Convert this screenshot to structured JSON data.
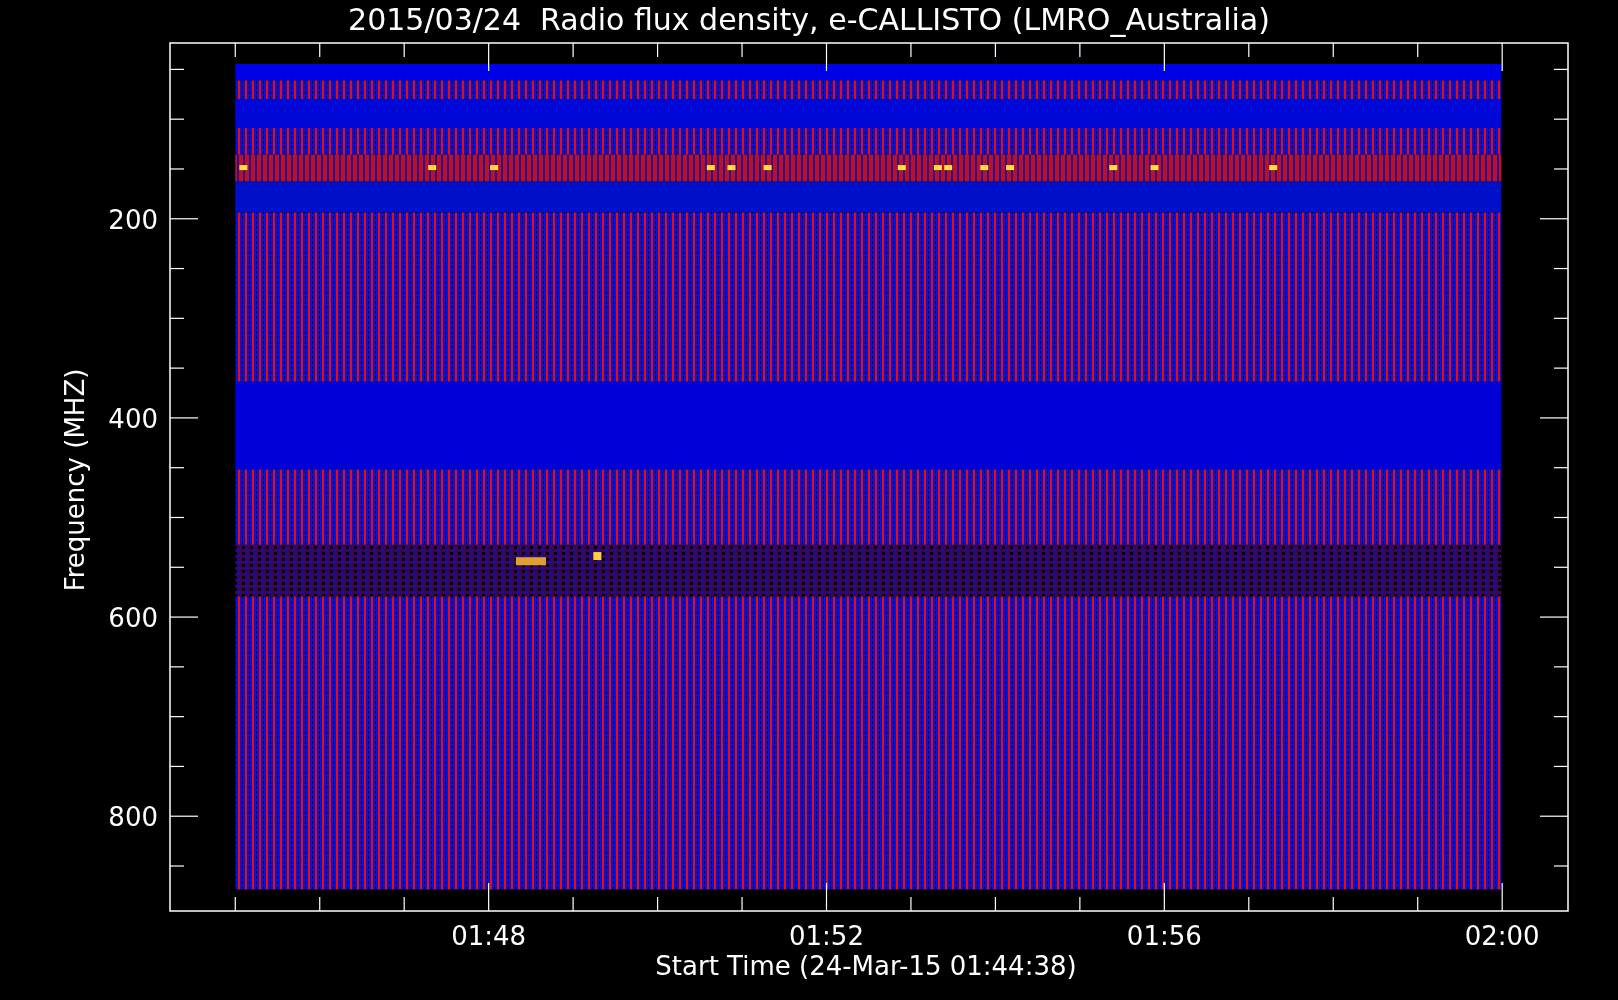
{
  "title": "2015/03/24  Radio flux density, e-CALLISTO (LMRO_Australia)",
  "y_axis": {
    "label": "Frequency (MHZ)",
    "ticks": [
      "200",
      "400",
      "600",
      "800"
    ]
  },
  "x_axis": {
    "label": "Start Time (24-Mar-15 01:44:38)",
    "ticks": [
      "01:48",
      "01:52",
      "01:56",
      "02:00"
    ]
  }
}
